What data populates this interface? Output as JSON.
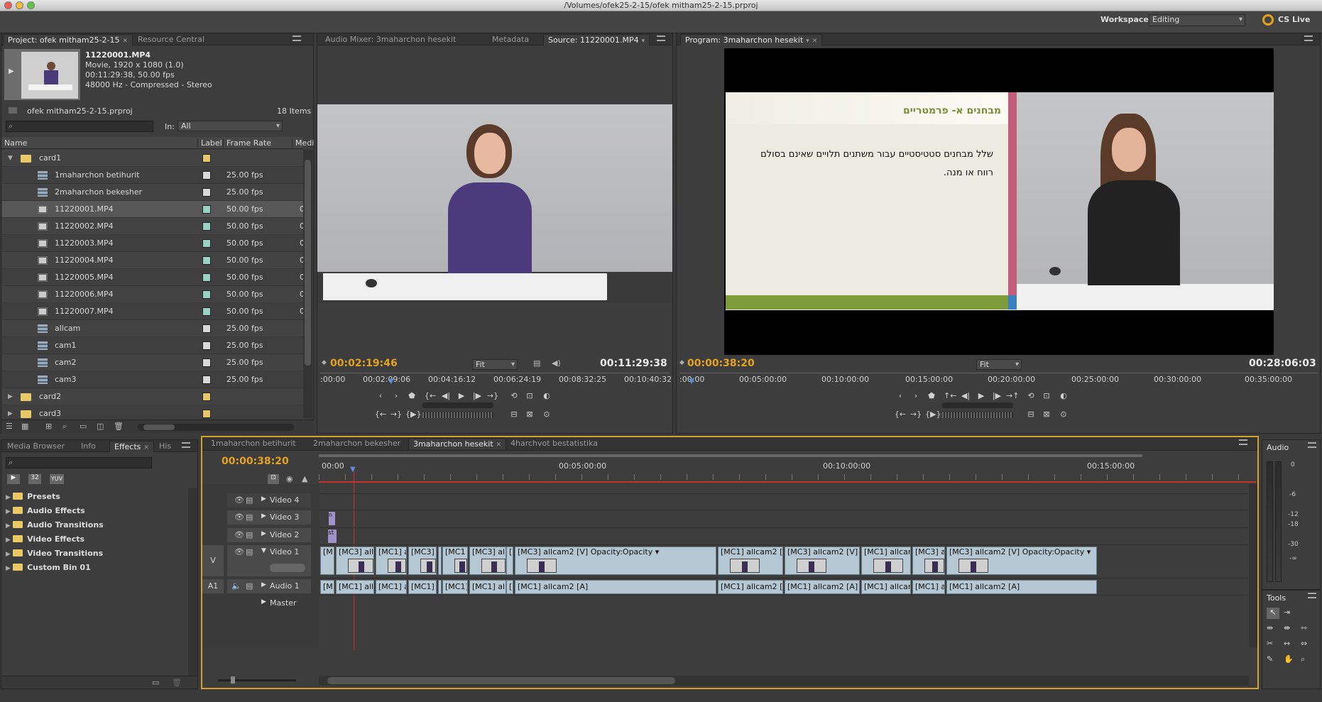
{
  "window": {
    "title": "/Volumes/ofek25-2-15/ofek mitham25-2-15.prproj"
  },
  "workspace": {
    "label": "Workspace:",
    "value": "Editing",
    "cslive": "CS Live"
  },
  "project": {
    "tab_active": "Project: ofek mitham25-2-15",
    "tab_other": "Resource Central",
    "clip_name": "11220001.MP4",
    "clip_line1": "Movie, 1920 x 1080 (1.0)",
    "clip_line2": "00:11:29:38, 50.00 fps",
    "clip_line3": "48000 Hz - Compressed - Stereo",
    "project_file": "ofek mitham25-2-15.prproj",
    "items": "18 Items",
    "search_placeholder": "",
    "in_label": "In:",
    "in_value": "All",
    "col_name": "Name",
    "col_label": "Label",
    "col_fps": "Frame Rate",
    "col_media": "Medi",
    "rows": [
      {
        "name": "card1",
        "fps": "",
        "color": "#e5c76b",
        "type": "folder"
      },
      {
        "name": "1maharchon betihurit",
        "fps": "25.00 fps",
        "color": "#d9d9d9",
        "type": "seq"
      },
      {
        "name": "2maharchon bekesher",
        "fps": "25.00 fps",
        "color": "#d9d9d9",
        "type": "seq"
      },
      {
        "name": "11220001.MP4",
        "fps": "50.00 fps",
        "color": "#9bd1c3",
        "type": "clip",
        "m": "0"
      },
      {
        "name": "11220002.MP4",
        "fps": "50.00 fps",
        "color": "#9bd1c3",
        "type": "clip",
        "m": "0"
      },
      {
        "name": "11220003.MP4",
        "fps": "50.00 fps",
        "color": "#9bd1c3",
        "type": "clip",
        "m": "0"
      },
      {
        "name": "11220004.MP4",
        "fps": "50.00 fps",
        "color": "#9bd1c3",
        "type": "clip",
        "m": "0"
      },
      {
        "name": "11220005.MP4",
        "fps": "50.00 fps",
        "color": "#9bd1c3",
        "type": "clip",
        "m": "0"
      },
      {
        "name": "11220006.MP4",
        "fps": "50.00 fps",
        "color": "#9bd1c3",
        "type": "clip",
        "m": "0"
      },
      {
        "name": "11220007.MP4",
        "fps": "50.00 fps",
        "color": "#9bd1c3",
        "type": "clip",
        "m": "0"
      },
      {
        "name": "allcam",
        "fps": "25.00 fps",
        "color": "#d9d9d9",
        "type": "seq"
      },
      {
        "name": "cam1",
        "fps": "25.00 fps",
        "color": "#d9d9d9",
        "type": "seq"
      },
      {
        "name": "cam2",
        "fps": "25.00 fps",
        "color": "#d9d9d9",
        "type": "seq"
      },
      {
        "name": "cam3",
        "fps": "25.00 fps",
        "color": "#d9d9d9",
        "type": "seq"
      },
      {
        "name": "card2",
        "fps": "",
        "color": "#e5c76b",
        "type": "folder"
      },
      {
        "name": "card3",
        "fps": "",
        "color": "#e5c76b",
        "type": "folder"
      }
    ]
  },
  "source": {
    "tabs": [
      "Audio Mixer: 3maharchon hesekit",
      "Metadata",
      "Source: 11220001.MP4"
    ],
    "tc_current": "00:02:19:46",
    "fit": "Fit",
    "tc_duration": "00:11:29:38",
    "ruler": [
      ":00:00",
      "00:02:09:06",
      "00:04:16:12",
      "00:06:24:19",
      "00:08:32:25",
      "00:10:40:32"
    ]
  },
  "program": {
    "tab": "Program: 3maharchon hesekit",
    "tc_current": "00:00:38:20",
    "fit": "Fit",
    "tc_duration": "00:28:06:03",
    "ruler": [
      ":00:00",
      "00:05:00:00",
      "00:10:00:00",
      "00:15:00:00",
      "00:20:00:00",
      "00:25:00:00",
      "00:30:00:00",
      "00:35:00:00"
    ],
    "slide_title": "מבחנים א- פרמטריים",
    "slide_line1": "שלל מבחנים סטטיסטיים עבור משתנים תלויים שאינם בסולם",
    "slide_line2": "רווח או מנה."
  },
  "effects": {
    "tabs": [
      "Media Browser",
      "Info",
      "Effects",
      "His"
    ],
    "items": [
      "Presets",
      "Audio Effects",
      "Audio Transitions",
      "Video Effects",
      "Video Transitions",
      "Custom Bin 01"
    ],
    "btn_32": "32",
    "btn_yuv": "YUV"
  },
  "timeline": {
    "tabs": [
      "1maharchon betihurit",
      "2maharchon bekesher",
      "3maharchon hesekit",
      "4harchvot bestatistika"
    ],
    "tc": "00:00:38:20",
    "ruler": [
      "00:00",
      "00:05:00:00",
      "00:10:00:00",
      "00:15:00:00"
    ],
    "tracks": {
      "v4": "Video 4",
      "v3": "Video 3",
      "v2": "Video 2",
      "v1": "Video 1",
      "a1": "Audio 1",
      "master": "Master",
      "v": "V",
      "a": "A1"
    },
    "v1_clips": [
      "[M",
      "[MC3] allca",
      "[MC1] al",
      "[MC3]",
      "[",
      "[MC1",
      "[MC3] allca",
      "[",
      "[MC3] allcam2 [V]  Opacity:Opacity ▾",
      "[MC1] allcam2 [V]",
      "[MC3] allcam2 [V]  ty ▾",
      "[MC1] allcam2",
      "[MC3] al",
      "[MC3] allcam2 [V]  Opacity:Opacity ▾"
    ],
    "a1_clips": [
      "[M",
      "[MC1] allca",
      "[MC1] al",
      "[MC1]",
      "[",
      "[MC1]",
      "[MC1] allca",
      "[",
      "[MC1] allcam2 [A]",
      "[MC1] allcam2 [A]",
      "[MC1] allcam2 [A]",
      "[MC1] allcam2",
      "[MC1] al",
      "[MC1] allcam2 [A]"
    ],
    "v3_clip": "n",
    "v2_clip": "st"
  },
  "audio": {
    "title": "Audio",
    "scale": [
      "0",
      "-6",
      "-12",
      "-18",
      "-30",
      "-∞"
    ]
  },
  "tools": {
    "title": "Tools"
  }
}
